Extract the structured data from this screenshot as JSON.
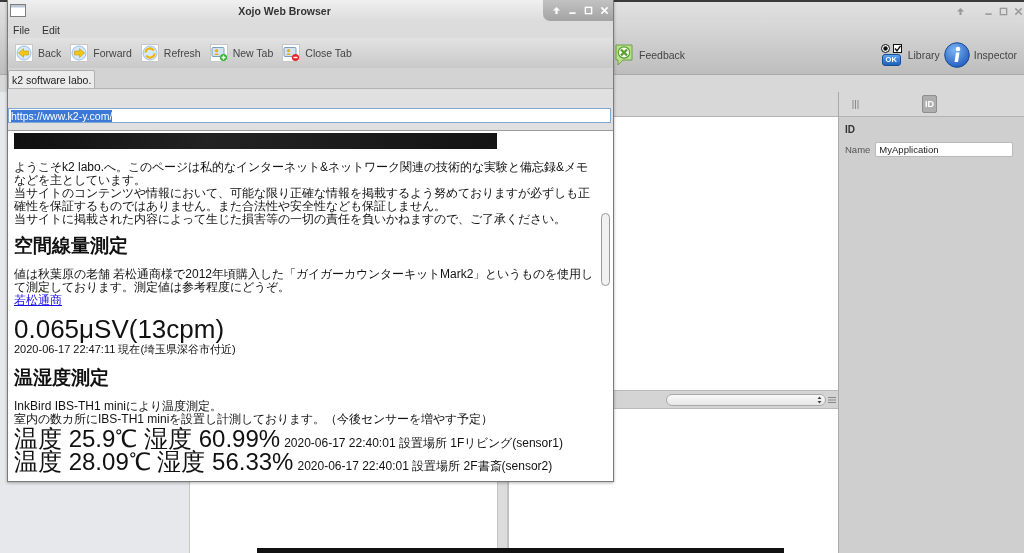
{
  "ide_window": {
    "toolbar": [
      {
        "kind": "feedback",
        "label": "Feedback"
      },
      {
        "kind": "library",
        "label": "Library",
        "badge": "OK"
      },
      {
        "kind": "inspector",
        "label": "Inspector"
      }
    ],
    "inspector": {
      "tabs": [
        {
          "kind": "icon",
          "selected": false
        },
        {
          "kind": "text",
          "label": "ID",
          "selected": true
        }
      ],
      "section": "ID",
      "fields": [
        {
          "label": "Name",
          "value": "MyApplication"
        }
      ]
    }
  },
  "browser_window": {
    "title": "Xojo Web Browser",
    "menu": [
      "File",
      "Edit"
    ],
    "toolbar": [
      {
        "kind": "back",
        "label": "Back"
      },
      {
        "kind": "forward",
        "label": "Forward"
      },
      {
        "kind": "refresh",
        "label": "Refresh"
      },
      {
        "kind": "new_tab",
        "label": "New Tab"
      },
      {
        "kind": "close_tab",
        "label": "Close Tab"
      }
    ],
    "tabs": [
      {
        "label": "k2 software labo.",
        "selected": true
      }
    ],
    "address": {
      "value": "https://www.k2-y.com/",
      "text_selected": true
    },
    "page": [
      {
        "kind": "banner"
      },
      {
        "kind": "paragraph",
        "lines": [
          "ようこそk2 labo.へ。このページは私的なインターネット&ネットワーク関連の技術的な実験と備忘録&メモなどを主としています。",
          "当サイトのコンテンツや情報において、可能な限り正確な情報を掲載するよう努めておりますが必ずしも正確性を保証するものではありません。また合法性や安全性なども保証しません。",
          "当サイトに掲載された内容によって生じた損害等の一切の責任を負いかねますので、ご了承ください。"
        ]
      },
      {
        "kind": "heading",
        "text": "空間線量測定"
      },
      {
        "kind": "paragraph",
        "lines": [
          "値は秋葉原の老舗 若松通商様で2012年頃購入した「ガイガーカウンターキットMark2」というものを使用して測定しております。測定値は参考程度にどうぞ。"
        ]
      },
      {
        "kind": "link",
        "text": "若松通商"
      },
      {
        "kind": "big_value",
        "text": "0.065μSV(13cpm)"
      },
      {
        "kind": "note",
        "text": "2020-06-17 22:47:11 現在(埼玉県深谷市付近)"
      },
      {
        "kind": "heading",
        "text": "温湿度測定"
      },
      {
        "kind": "paragraph",
        "lines": [
          "InkBird IBS-TH1 miniにより温度測定。",
          "室内の数カ所にIBS-TH1 miniを設置し計測しております。（今後センサーを増やす予定）"
        ]
      },
      {
        "kind": "reading",
        "value": "温度 25.9℃ 湿度 60.99%",
        "note": "2020-06-17 22:40:01 設置場所 1Fリビング(sensor1)"
      },
      {
        "kind": "reading",
        "value": "温度 28.09℃ 湿度 56.33%",
        "note": "2020-06-17 22:40:01 設置場所 2F書斎(sensor2)"
      }
    ]
  }
}
